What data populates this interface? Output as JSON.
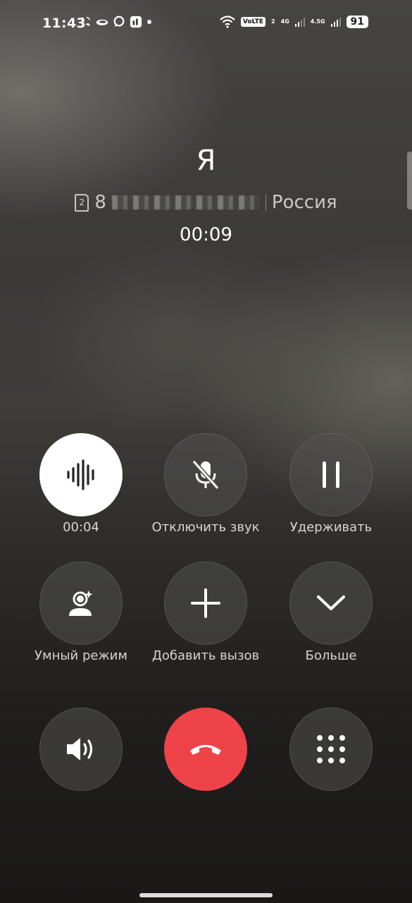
{
  "status_bar": {
    "time": "11:43",
    "left_icons": [
      "wifi-call-icon",
      "cloud-icon",
      "chat-bubble-icon",
      "app-notification-icon",
      "dot-icon"
    ],
    "volte": "VoLTE",
    "volte_sub": "2",
    "net1": "4G",
    "net2": "4.5G",
    "battery": "91"
  },
  "call": {
    "name": "Я",
    "sim": "2",
    "number_prefix": "8",
    "country": "Россия",
    "duration": "00:09"
  },
  "buttons": {
    "recording": {
      "label": "00:04",
      "icon": "waveform-icon"
    },
    "mute": {
      "label": "Отключить звук",
      "icon": "mic-off-icon"
    },
    "hold": {
      "label": "Удерживать",
      "icon": "pause-icon"
    },
    "smart_mode": {
      "label": "Умный режим",
      "icon": "smart-person-icon"
    },
    "add_call": {
      "label": "Добавить вызов",
      "icon": "plus-icon"
    },
    "more": {
      "label": "Больше",
      "icon": "chevron-down-icon"
    },
    "speaker": {
      "icon": "speaker-icon"
    },
    "end_call": {
      "icon": "hangup-icon",
      "color": "#ee4349"
    },
    "keypad": {
      "icon": "keypad-icon"
    }
  }
}
